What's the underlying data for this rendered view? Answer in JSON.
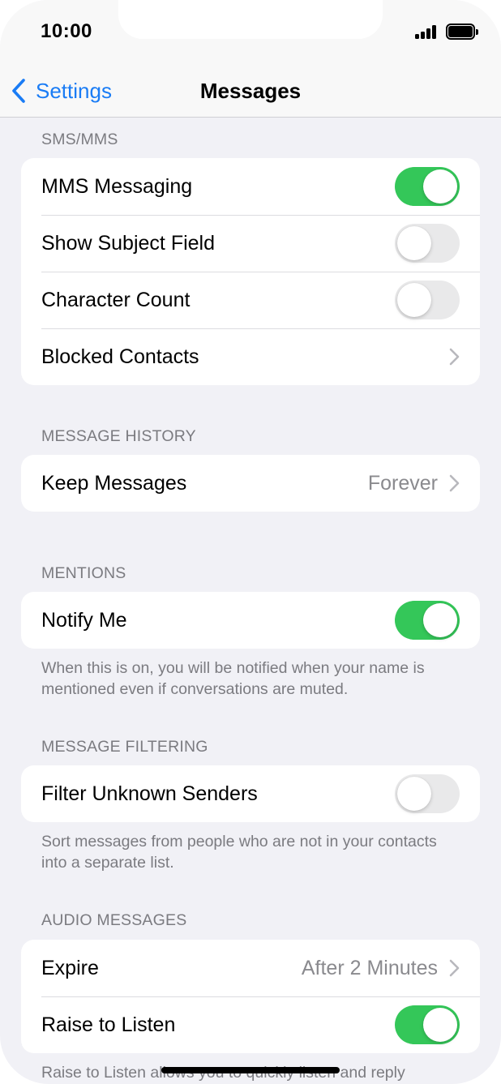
{
  "status_bar": {
    "time": "10:00"
  },
  "nav": {
    "back_label": "Settings",
    "title": "Messages"
  },
  "sections": {
    "sms": {
      "header": "SMS/MMS",
      "mms_label": "MMS Messaging",
      "mms_on": true,
      "subject_label": "Show Subject Field",
      "subject_on": false,
      "charcount_label": "Character Count",
      "charcount_on": false,
      "blocked_label": "Blocked Contacts"
    },
    "history": {
      "header": "MESSAGE HISTORY",
      "keep_label": "Keep Messages",
      "keep_value": "Forever"
    },
    "mentions": {
      "header": "MENTIONS",
      "notify_label": "Notify Me",
      "notify_on": true,
      "footer": "When this is on, you will be notified when your name is mentioned even if conversations are muted."
    },
    "filtering": {
      "header": "MESSAGE FILTERING",
      "filter_label": "Filter Unknown Senders",
      "filter_on": false,
      "footer": "Sort messages from people who are not in your contacts into a separate list."
    },
    "audio": {
      "header": "AUDIO MESSAGES",
      "expire_label": "Expire",
      "expire_value": "After 2 Minutes",
      "raise_label": "Raise to Listen",
      "raise_on": true,
      "footer": "Raise to Listen allows you to quickly listen and reply"
    }
  },
  "colors": {
    "accent": "#1a7cf5",
    "toggle_on": "#34c759",
    "toggle_off": "#e9e9ea",
    "background": "#f1f1f6"
  }
}
